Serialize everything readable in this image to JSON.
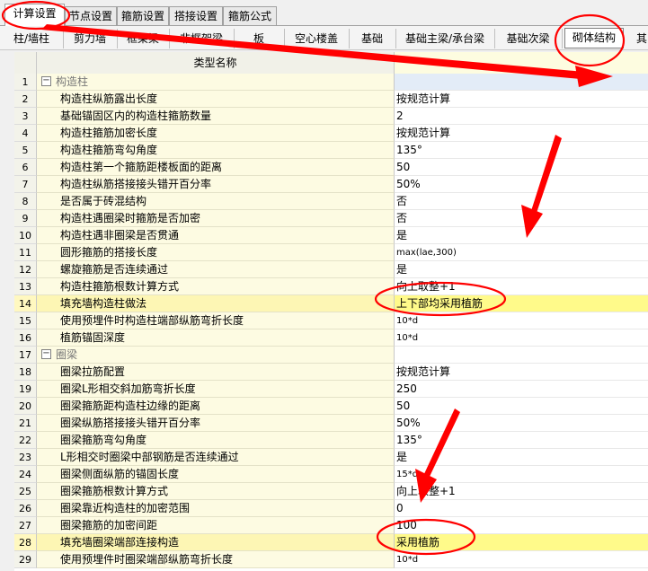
{
  "top_tabs": [
    "计算设置",
    "节点设置",
    "箍筋设置",
    "搭接设置",
    "箍筋公式"
  ],
  "sub_tabs": [
    "柱/墙柱",
    "剪力墙",
    "框架梁",
    "非框架梁",
    "板",
    "空心楼盖",
    "基础",
    "基础主梁/承台梁",
    "基础次梁",
    "砌体结构",
    "其"
  ],
  "table": {
    "header_name": "类型名称",
    "rows": [
      {
        "num": "1",
        "name": "构造柱",
        "value": "",
        "group": true
      },
      {
        "num": "2",
        "name": "构造柱纵筋露出长度",
        "value": "按规范计算"
      },
      {
        "num": "3",
        "name": "基础锚固区内的构造柱箍筋数量",
        "value": "2"
      },
      {
        "num": "4",
        "name": "构造柱箍筋加密长度",
        "value": "按规范计算"
      },
      {
        "num": "5",
        "name": "构造柱箍筋弯勾角度",
        "value": "135°"
      },
      {
        "num": "6",
        "name": "构造柱第一个箍筋距楼板面的距离",
        "value": "50"
      },
      {
        "num": "7",
        "name": "构造柱纵筋搭接接头错开百分率",
        "value": "50%"
      },
      {
        "num": "8",
        "name": "是否属于砖混结构",
        "value": "否"
      },
      {
        "num": "9",
        "name": "构造柱遇圈梁时箍筋是否加密",
        "value": "否"
      },
      {
        "num": "10",
        "name": "构造柱遇非圈梁是否贯通",
        "value": "是"
      },
      {
        "num": "11",
        "name": "圆形箍筋的搭接长度",
        "value": "max(lae,300)"
      },
      {
        "num": "12",
        "name": "螺旋箍筋是否连续通过",
        "value": "是"
      },
      {
        "num": "13",
        "name": "构造柱箍筋根数计算方式",
        "value": "向上取整+1"
      },
      {
        "num": "14",
        "name": "填充墙构造柱做法",
        "value": "上下部均采用植筋",
        "highlight": true,
        "selected": true
      },
      {
        "num": "15",
        "name": "使用预埋件时构造柱端部纵筋弯折长度",
        "value": "10*d"
      },
      {
        "num": "16",
        "name": "植筋锚固深度",
        "value": "10*d"
      },
      {
        "num": "17",
        "name": "圈梁",
        "value": "",
        "group": true
      },
      {
        "num": "18",
        "name": "圈梁拉筋配置",
        "value": "按规范计算"
      },
      {
        "num": "19",
        "name": "圈梁L形相交斜加筋弯折长度",
        "value": "250"
      },
      {
        "num": "20",
        "name": "圈梁箍筋距构造柱边缘的距离",
        "value": "50"
      },
      {
        "num": "21",
        "name": "圈梁纵筋搭接接头错开百分率",
        "value": "50%"
      },
      {
        "num": "22",
        "name": "圈梁箍筋弯勾角度",
        "value": "135°"
      },
      {
        "num": "23",
        "name": "L形相交时圈梁中部钢筋是否连续通过",
        "value": "是"
      },
      {
        "num": "24",
        "name": "圈梁侧面纵筋的锚固长度",
        "value": "15*d"
      },
      {
        "num": "25",
        "name": "圈梁箍筋根数计算方式",
        "value": "向上取整+1"
      },
      {
        "num": "26",
        "name": "圈梁靠近构造柱的加密范围",
        "value": "0"
      },
      {
        "num": "27",
        "name": "圈梁箍筋的加密间距",
        "value": "100"
      },
      {
        "num": "28",
        "name": "填充墙圈梁端部连接构造",
        "value": "采用植筋",
        "highlight": true,
        "selected": true
      },
      {
        "num": "29",
        "name": "使用预埋件时圈梁端部纵筋弯折长度",
        "value": "10*d"
      }
    ]
  },
  "colors": {
    "annotation": "#ff0000",
    "highlight": "#fffa8a",
    "name_bg": "#fdfbe2"
  }
}
